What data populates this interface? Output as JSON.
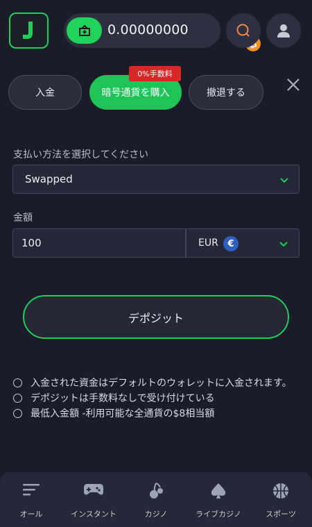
{
  "header": {
    "logo_letter": "J",
    "balance": "0.00000000",
    "crypto_symbol": "₿"
  },
  "tabs": [
    {
      "label": "入金"
    },
    {
      "label": "暗号通貨を購入",
      "active": true
    },
    {
      "label": "撤退する"
    }
  ],
  "fee_badge": "0%手数料",
  "payment": {
    "label": "支払い方法を選択してください",
    "selected": "Swapped"
  },
  "amount": {
    "label": "金額",
    "value": "100"
  },
  "currency": {
    "selected": "EUR",
    "symbol": "€"
  },
  "deposit_button": "デポジット",
  "notes": [
    "入金された資金はデフォルトのウォレットに入金されます。",
    "デポジットは手数料なしで受け付けている",
    "最低入金額 -利用可能な全通貨の$8相当額"
  ],
  "bottom_nav": [
    {
      "label": "オール",
      "icon": "list-icon"
    },
    {
      "label": "インスタント",
      "icon": "gamepad-icon"
    },
    {
      "label": "カジノ",
      "icon": "cherry-icon"
    },
    {
      "label": "ライブカジノ",
      "icon": "spade-icon"
    },
    {
      "label": "スポーツ",
      "icon": "basketball-icon"
    }
  ],
  "colors": {
    "background": "#1a1d29",
    "accent_green": "#1fce5a",
    "badge_red": "#d82727",
    "bitcoin": "#f7931a",
    "euro": "#2f5fc4"
  }
}
